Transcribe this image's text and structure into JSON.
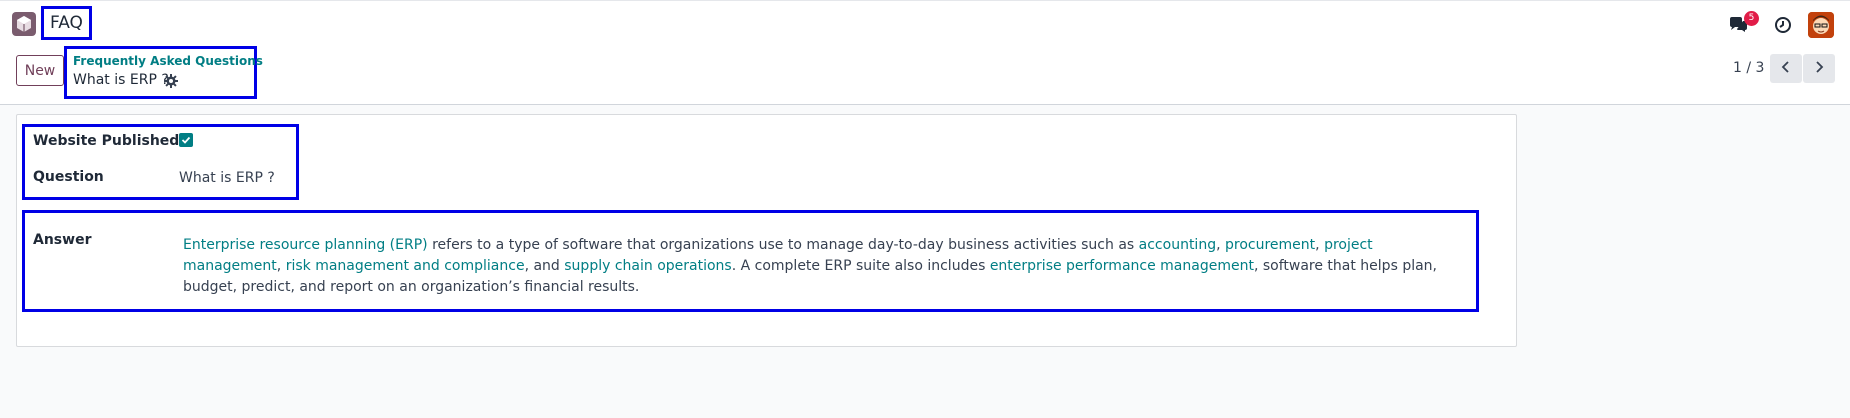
{
  "navbar": {
    "app_icon": "app-cube-icon",
    "app_name": "FAQ",
    "messages_icon": "chat-bubbles-icon",
    "messages_count": "5",
    "activity_icon": "clock-icon",
    "avatar": "user-avatar"
  },
  "control_panel": {
    "new_label": "New",
    "breadcrumb_parent": "Frequently Asked Questions",
    "record_title": "What is ERP ?",
    "gear_icon": "gear-icon",
    "pager_value": "1 / 3",
    "prev_icon": "chevron-left-icon",
    "next_icon": "chevron-right-icon"
  },
  "form": {
    "website_published_label": "Website Published ?",
    "website_published": true,
    "question_label": "Question",
    "question_value": "What is ERP ?",
    "answer_label": "Answer",
    "answer_parts": [
      {
        "text": "Enterprise resource planning (ERP)",
        "link": true
      },
      {
        "text": " refers to a type of software that organizations use to manage day-to-day business activities such as ",
        "link": false
      },
      {
        "text": "accounting",
        "link": true
      },
      {
        "text": ", ",
        "link": false
      },
      {
        "text": "procurement",
        "link": true
      },
      {
        "text": ", ",
        "link": false
      },
      {
        "text": "project management",
        "link": true
      },
      {
        "text": ", ",
        "link": false
      },
      {
        "text": "risk management and compliance",
        "link": true
      },
      {
        "text": ", and ",
        "link": false
      },
      {
        "text": "supply chain operations",
        "link": true
      },
      {
        "text": ". A complete ERP suite also includes ",
        "link": false
      },
      {
        "text": "enterprise performance management",
        "link": true
      },
      {
        "text": ", software that helps plan, budget, predict, and report on an organization’s financial results.",
        "link": false
      }
    ]
  },
  "colors": {
    "accent": "#017e84",
    "brand": "#71405a",
    "highlight_box": "#0000e6",
    "badge": "#e11d48"
  }
}
